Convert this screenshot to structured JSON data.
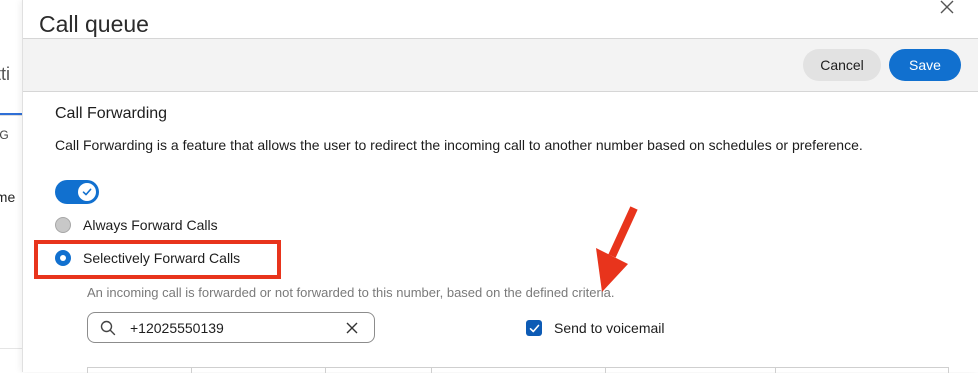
{
  "background": {
    "tab_fragment": "etti",
    "text_fragment_1": "nt G",
    "text_fragment_2": "eme"
  },
  "modal": {
    "title": "Call queue",
    "close_icon": "close-icon"
  },
  "actions": {
    "cancel_label": "Cancel",
    "save_label": "Save"
  },
  "call_forwarding": {
    "title": "Call Forwarding",
    "description": "Call Forwarding is a feature that allows the user to redirect the incoming call to another number based on schedules or preference.",
    "enabled": true,
    "options": [
      {
        "label": "Always Forward Calls",
        "selected": false
      },
      {
        "label": "Selectively Forward Calls",
        "selected": true
      }
    ],
    "hint": "An incoming call is forwarded or not forwarded to this number, based on the defined criteria.",
    "phone_number": "+12025550139",
    "send_to_voicemail_label": "Send to voicemail",
    "send_to_voicemail_checked": true
  },
  "colors": {
    "accent": "#1170cf",
    "annotation": "#e8341c"
  }
}
